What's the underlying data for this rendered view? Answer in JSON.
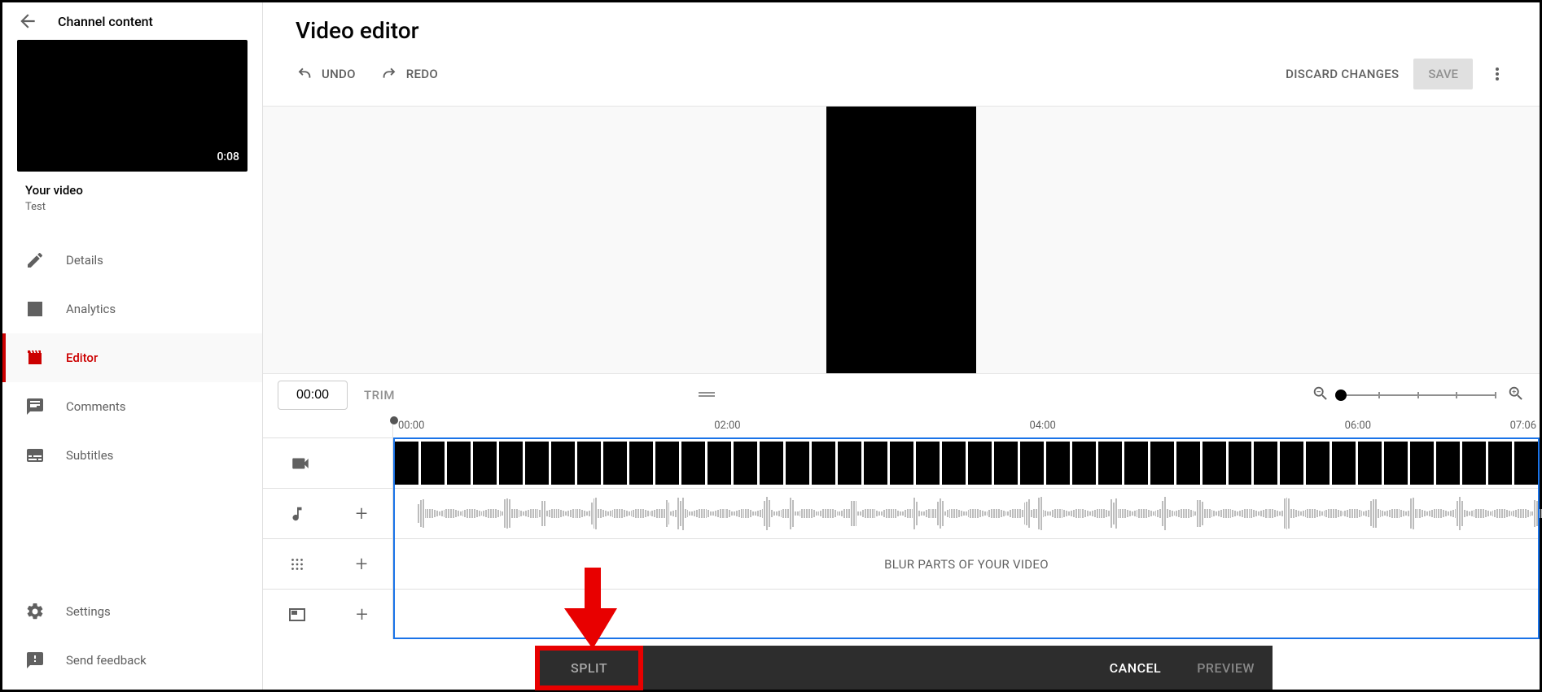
{
  "sidebar": {
    "back_label": "Channel content",
    "thumb_duration": "0:08",
    "your_video_label": "Your video",
    "video_title": "Test",
    "nav": {
      "details": "Details",
      "analytics": "Analytics",
      "editor": "Editor",
      "comments": "Comments",
      "subtitles": "Subtitles",
      "settings": "Settings",
      "feedback": "Send feedback"
    }
  },
  "header": {
    "page_title": "Video editor",
    "undo": "UNDO",
    "redo": "REDO",
    "discard": "DISCARD CHANGES",
    "save": "SAVE"
  },
  "controls": {
    "time_value": "00:00",
    "trim": "TRIM"
  },
  "ruler": {
    "t0": "00:00",
    "t1": "02:00",
    "t2": "04:00",
    "t3": "06:00",
    "t4": "07:06"
  },
  "blur_track_text": "BLUR PARTS OF YOUR VIDEO",
  "action_bar": {
    "split": "SPLIT",
    "cancel": "CANCEL",
    "preview": "PREVIEW"
  }
}
